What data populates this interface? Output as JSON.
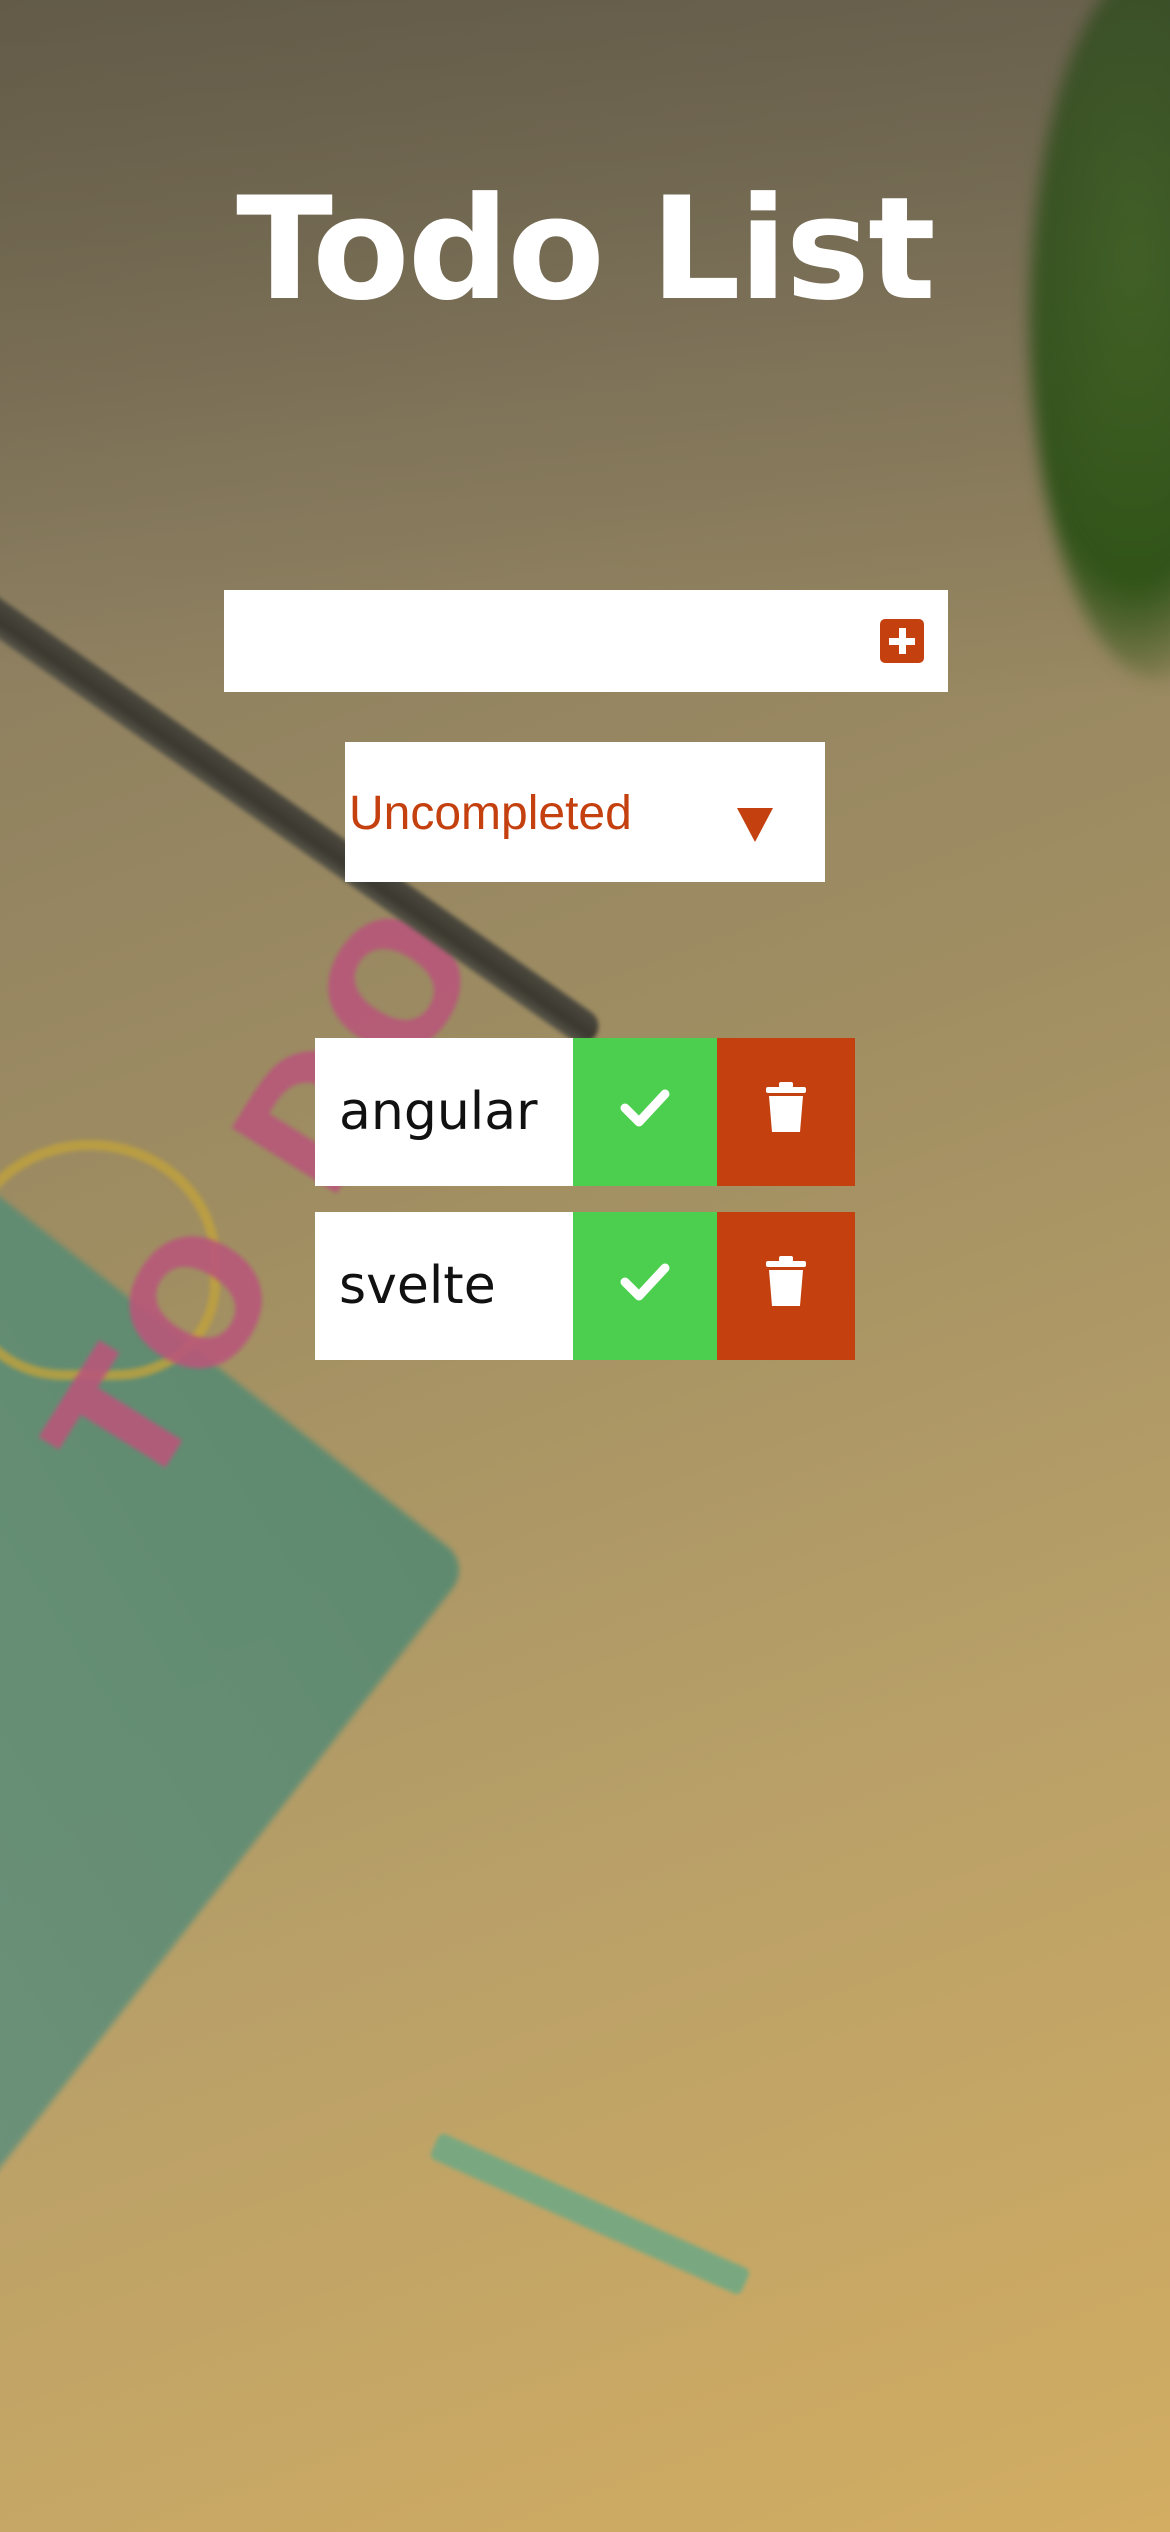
{
  "header": {
    "title": "Todo List"
  },
  "add_form": {
    "input_value": "",
    "input_placeholder": "",
    "add_button_icon": "plus-square-icon",
    "accent_color": "#c4400e"
  },
  "filter": {
    "selected": "Uncompleted",
    "arrow_icon": "caret-down-icon"
  },
  "todos": [
    {
      "text": "angular",
      "complete_icon": "check-icon",
      "delete_icon": "trash-icon"
    },
    {
      "text": "svelte",
      "complete_icon": "check-icon",
      "delete_icon": "trash-icon"
    }
  ],
  "colors": {
    "complete": "#4ccf4f",
    "delete": "#c4400e",
    "title": "#ffffff"
  }
}
